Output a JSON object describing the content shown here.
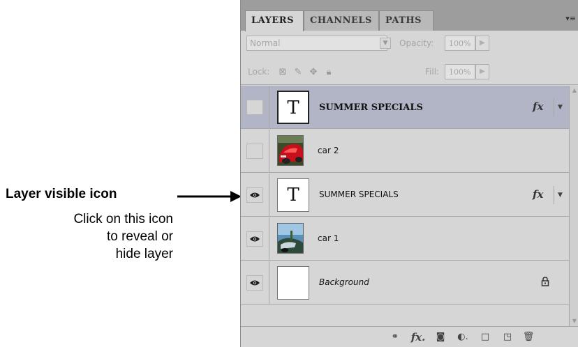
{
  "annotation": {
    "title": "Layer visible icon",
    "desc_lines": [
      "Click on this icon",
      "to reveal or",
      "hide layer"
    ]
  },
  "tabs": [
    {
      "label": "LAYERS"
    },
    {
      "label": "CHANNELS"
    },
    {
      "label": "PATHS"
    }
  ],
  "panel_menu_icon": "panel-menu-icon",
  "blend_mode": "Normal",
  "opacity_label": "Opacity:",
  "opacity_value": "100%",
  "lock_label": "Lock:",
  "fill_label": "Fill:",
  "fill_value": "100%",
  "layers": [
    {
      "name": "SUMMER SPECIALS",
      "type": "text",
      "visible": false,
      "selected": true,
      "fx": "fx"
    },
    {
      "name": "car 2",
      "type": "image",
      "visible": false,
      "selected": false
    },
    {
      "name": "SUMMER SPECIALS",
      "type": "text",
      "visible": true,
      "selected": false,
      "fx": "fx"
    },
    {
      "name": "car 1",
      "type": "image",
      "visible": true,
      "selected": false
    },
    {
      "name": "Background",
      "type": "background",
      "visible": true,
      "selected": false
    }
  ],
  "thumb_text": "T",
  "colors": {
    "panel_bg": "#d6d6d6",
    "selected_row": "#b2b5c6",
    "tab_bar": "#9d9d9d"
  }
}
